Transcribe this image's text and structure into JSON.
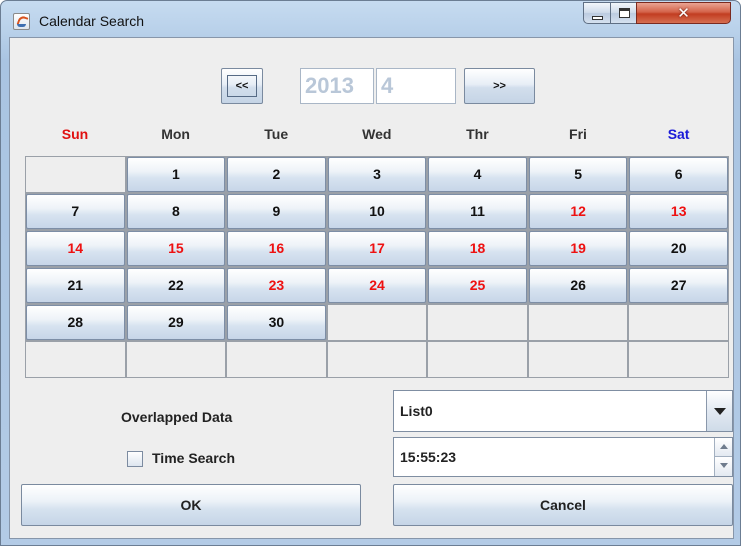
{
  "window": {
    "title": "Calendar Search"
  },
  "nav": {
    "prev_label": "<<",
    "next_label": ">>",
    "year": "2013",
    "month": "4"
  },
  "weekdays": [
    "Sun",
    "Mon",
    "Tue",
    "Wed",
    "Thr",
    "Fri",
    "Sat"
  ],
  "calendar_days": [
    "",
    "1",
    "2",
    "3",
    "4",
    "5",
    "6",
    "7",
    "8",
    "9",
    "10",
    "11",
    "12",
    "13",
    "14",
    "15",
    "16",
    "17",
    "18",
    "19",
    "20",
    "21",
    "22",
    "23",
    "24",
    "25",
    "26",
    "27",
    "28",
    "29",
    "30",
    "",
    "",
    "",
    "",
    "",
    "",
    "",
    "",
    "",
    "",
    ""
  ],
  "highlighted_days": [
    "12",
    "13",
    "14",
    "15",
    "16",
    "17",
    "18",
    "19",
    "23",
    "24",
    "25"
  ],
  "colors": {
    "highlight_day": "#ee1111",
    "sunday_header": "#e01010",
    "saturday_header": "#1a1ad8"
  },
  "form": {
    "overlapped_label": "Overlapped Data",
    "overlapped_value": "List0",
    "time_search_label": "Time Search",
    "time_search_checked": false,
    "time_value": "15:55:23"
  },
  "buttons": {
    "ok": "OK",
    "cancel": "Cancel"
  }
}
